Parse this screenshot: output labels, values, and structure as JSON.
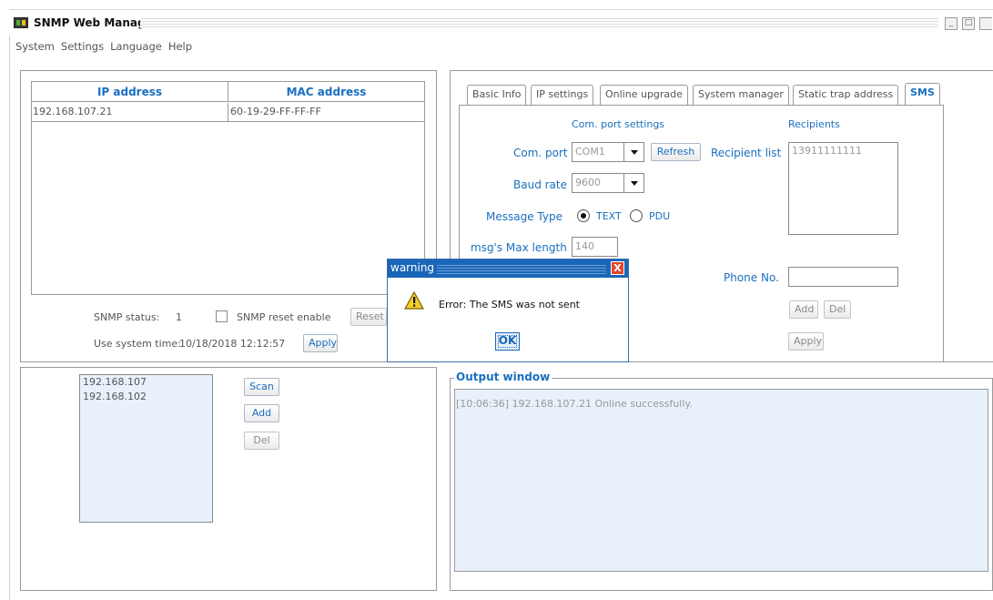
{
  "window": {
    "title": "SNMP Web Manager",
    "controls": {
      "minimize": "_",
      "maximize": "□"
    }
  },
  "menu": [
    "System",
    "Settings",
    "Language",
    "Help"
  ],
  "devices": {
    "columns": [
      "IP address",
      "MAC address"
    ],
    "rows": [
      {
        "ip": "192.168.107.21",
        "mac": "60-19-29-FF-FF-FF"
      }
    ]
  },
  "status": {
    "snmp_status_label": "SNMP status:",
    "snmp_status_value": "1",
    "reset_enable_label": "SNMP reset enable",
    "reset_enable_checked": false,
    "reset_button": "Reset",
    "system_time_label": "Use system time:",
    "system_time_value": "10/18/2018 12:12:57",
    "apply_button": "Apply"
  },
  "scan": {
    "subnets": [
      "192.168.107",
      "192.168.102"
    ],
    "scan_button": "Scan",
    "add_button": "Add",
    "del_button": "Del"
  },
  "tabs": [
    "Basic Info",
    "IP settings",
    "Online upgrade",
    "System manager",
    "Static trap address",
    "SMS"
  ],
  "active_tab": "SMS",
  "sms": {
    "com_section_title": "Com. port settings",
    "recipients_title": "Recipients",
    "com_port_label": "Com. port",
    "com_port_value": "COM1",
    "refresh_button": "Refresh",
    "baud_rate_label": "Baud rate",
    "baud_rate_value": "9600",
    "message_type_label": "Message Type",
    "message_type_options": [
      "TEXT",
      "PDU"
    ],
    "message_type_selected": "TEXT",
    "max_length_label": "msg's Max length",
    "max_length_value": "140",
    "recipient_list_label": "Recipient list",
    "recipient_list": [
      "13911111111"
    ],
    "phone_label": "Phone No.",
    "phone_value": "",
    "add_button": "Add",
    "del_button": "Del",
    "apply_button": "Apply"
  },
  "output": {
    "title": "Output window",
    "lines": [
      "[10:06:36]  192.168.107.21 Online successfully."
    ]
  },
  "dialog": {
    "title": "warning",
    "close": "X",
    "message": "Error: The SMS was not sent",
    "ok_button": "OK"
  },
  "colors": {
    "accent": "#1a6fc0",
    "dialog_title_bg": "#1a66b8",
    "list_bg": "#e8f1fb"
  }
}
